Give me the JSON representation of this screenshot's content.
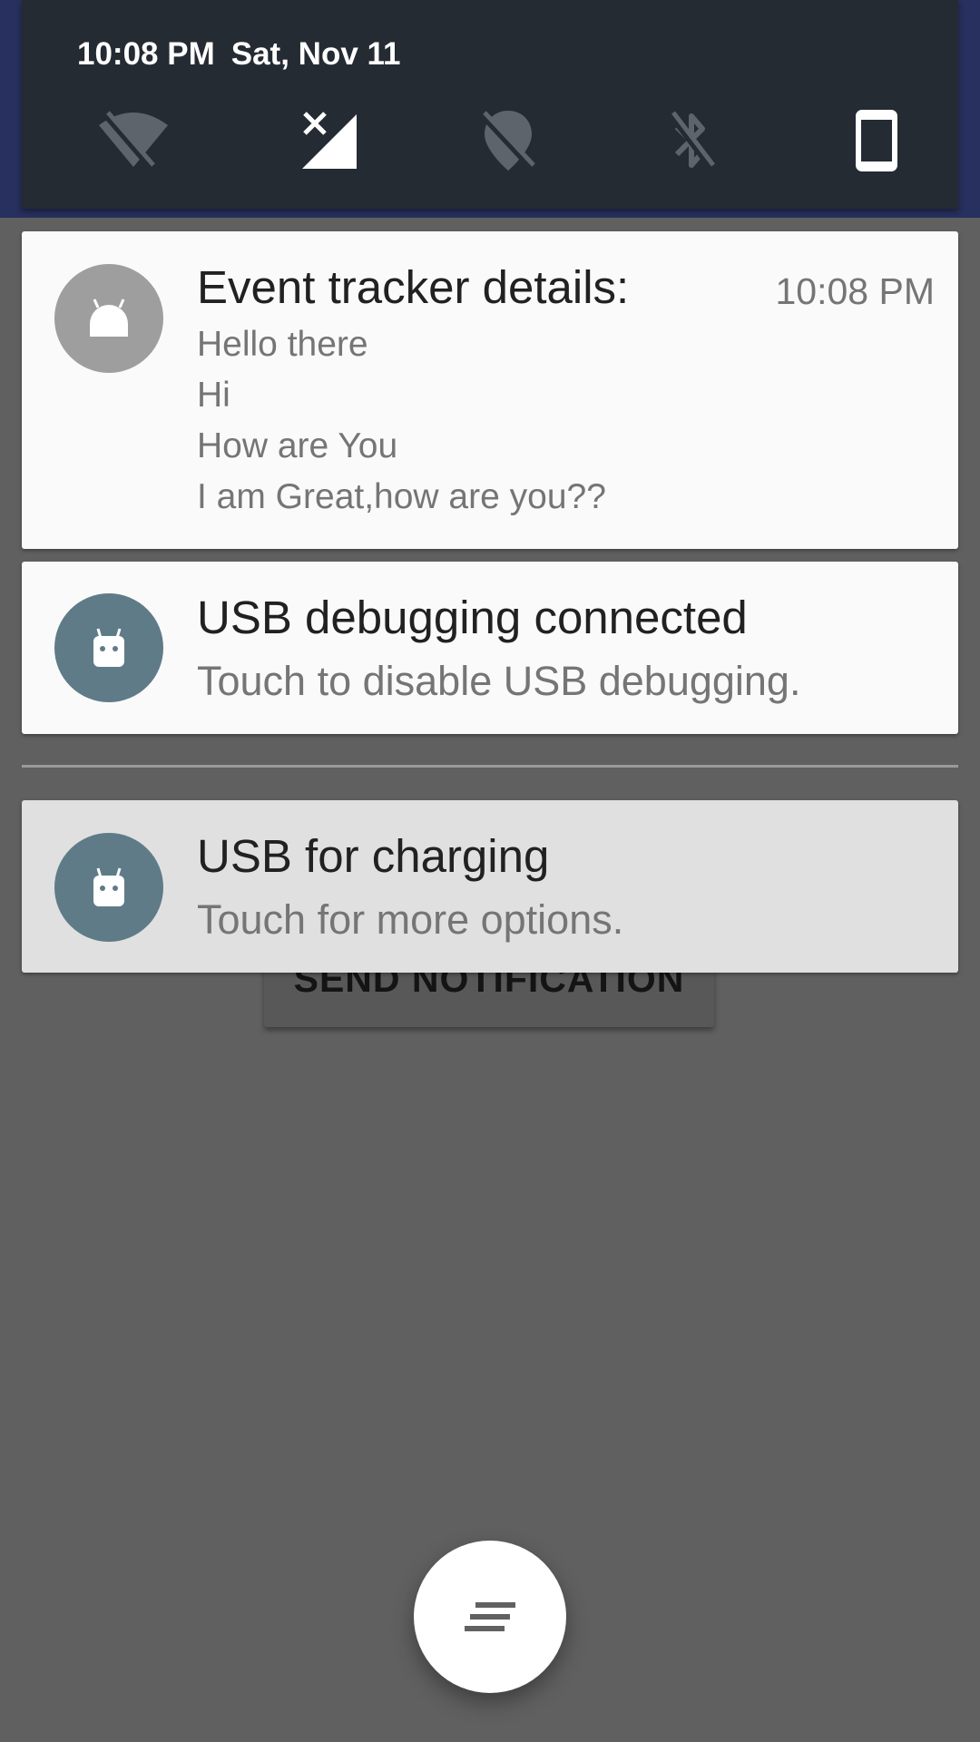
{
  "status_bar": {
    "time": "10:08 PM",
    "date": "Sat, Nov 11"
  },
  "quick_settings": [
    {
      "icon": "wifi-off-icon",
      "state": "off"
    },
    {
      "icon": "cellular-no-signal-icon",
      "state": "no-sim"
    },
    {
      "icon": "location-off-icon",
      "state": "off"
    },
    {
      "icon": "bluetooth-off-icon",
      "state": "off"
    },
    {
      "icon": "auto-rotate-portrait-icon",
      "state": "on"
    }
  ],
  "notifications": [
    {
      "title": "Event tracker details:",
      "time": "10:08 PM",
      "lines": [
        "Hello there",
        "Hi",
        "How are You",
        "I am Great,how are you??"
      ],
      "icon": "android-icon"
    },
    {
      "title": "USB debugging connected",
      "subtitle": "Touch to disable USB debugging.",
      "icon": "android-icon"
    },
    {
      "title": "USB for charging",
      "subtitle": "Touch for more options.",
      "icon": "android-icon"
    }
  ],
  "app": {
    "button_label": "SEND NOTIFICATION"
  },
  "fab": {
    "icon": "clear-all-icon"
  },
  "colors": {
    "qs_background": "#252b33",
    "notification_background": "#fafafa",
    "avatar_slate": "#5f7b87",
    "avatar_grey": "#9e9e9e",
    "scrim": "#606060"
  }
}
